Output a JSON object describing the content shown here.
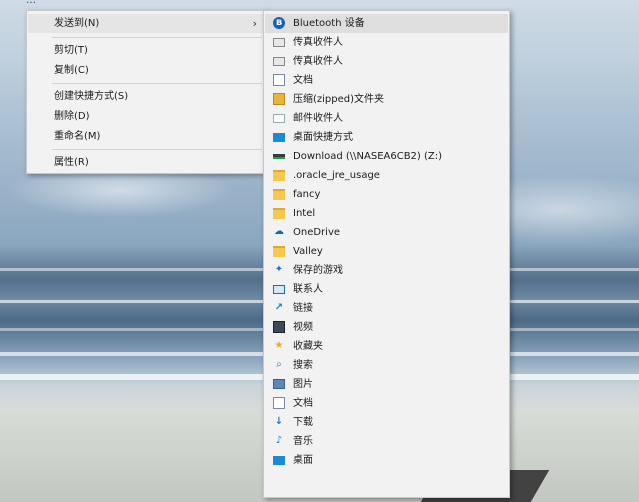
{
  "top_strip": "…",
  "primary_menu": {
    "items": [
      {
        "label": "发送到(N)"
      },
      {
        "label": "剪切(T)"
      },
      {
        "label": "复制(C)"
      },
      {
        "label": "创建快捷方式(S)"
      },
      {
        "label": "删除(D)"
      },
      {
        "label": "重命名(M)"
      },
      {
        "label": "属性(R)"
      }
    ],
    "submenu_arrow": "›"
  },
  "sendto_menu": {
    "items": [
      {
        "label": "Bluetooth 设备",
        "icon": "bluetooth-icon",
        "glyph": "ʙ"
      },
      {
        "label": "传真收件人",
        "icon": "fax-icon",
        "glyph": ""
      },
      {
        "label": "传真收件人",
        "icon": "fax-icon",
        "glyph": ""
      },
      {
        "label": "文档",
        "icon": "document-icon",
        "glyph": ""
      },
      {
        "label": "压缩(zipped)文件夹",
        "icon": "zip-folder-icon",
        "glyph": ""
      },
      {
        "label": "邮件收件人",
        "icon": "mail-icon",
        "glyph": ""
      },
      {
        "label": "桌面快捷方式",
        "icon": "desktop-shortcut-icon",
        "glyph": ""
      },
      {
        "label": "Download (\\\\NASEA6CB2) (Z:)",
        "icon": "network-drive-icon",
        "glyph": ""
      },
      {
        "label": ".oracle_jre_usage",
        "icon": "folder-icon",
        "glyph": ""
      },
      {
        "label": "fancy",
        "icon": "folder-icon",
        "glyph": ""
      },
      {
        "label": "Intel",
        "icon": "folder-icon",
        "glyph": ""
      },
      {
        "label": "OneDrive",
        "icon": "onedrive-icon",
        "glyph": "☁"
      },
      {
        "label": "Valley",
        "icon": "folder-icon",
        "glyph": ""
      },
      {
        "label": "保存的游戏",
        "icon": "saved-games-icon",
        "glyph": "✦"
      },
      {
        "label": "联系人",
        "icon": "contacts-icon",
        "glyph": ""
      },
      {
        "label": "链接",
        "icon": "links-icon",
        "glyph": "↗"
      },
      {
        "label": "视频",
        "icon": "videos-icon",
        "glyph": ""
      },
      {
        "label": "收藏夹",
        "icon": "favorites-icon",
        "glyph": "★"
      },
      {
        "label": "搜索",
        "icon": "search-icon",
        "glyph": "⌕"
      },
      {
        "label": "图片",
        "icon": "pictures-icon",
        "glyph": ""
      },
      {
        "label": "文档",
        "icon": "documents-icon",
        "glyph": ""
      },
      {
        "label": "下载",
        "icon": "downloads-icon",
        "glyph": "↓"
      },
      {
        "label": "音乐",
        "icon": "music-icon",
        "glyph": "♪"
      },
      {
        "label": "桌面",
        "icon": "desktop-icon",
        "glyph": ""
      }
    ]
  },
  "colors": {
    "menu_bg": "#f2f2f2",
    "highlight": "#e5e5e5",
    "accent": "#1a76d2"
  }
}
